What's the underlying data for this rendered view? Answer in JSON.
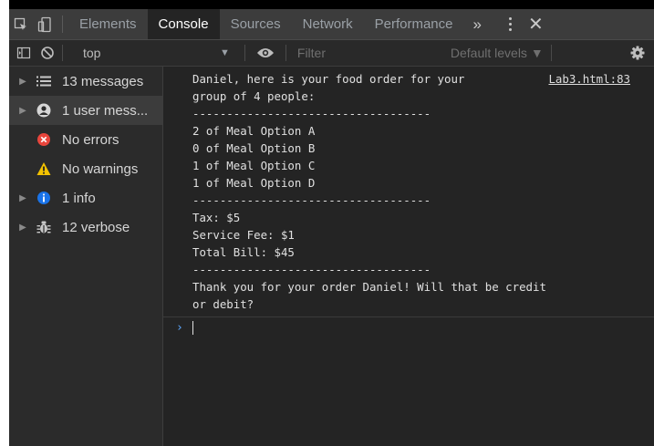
{
  "tabs": {
    "elements": "Elements",
    "console": "Console",
    "sources": "Sources",
    "network": "Network",
    "performance": "Performance",
    "more": "»"
  },
  "toolbar": {
    "context": "top",
    "filter_placeholder": "Filter",
    "levels": "Default levels ▼"
  },
  "sidebar": {
    "items": [
      {
        "label": "13 messages",
        "icon": "list-icon"
      },
      {
        "label": "1 user mess...",
        "icon": "user-icon"
      },
      {
        "label": "No errors",
        "icon": "error-icon"
      },
      {
        "label": "No warnings",
        "icon": "warning-icon"
      },
      {
        "label": "1 info",
        "icon": "info-icon"
      },
      {
        "label": "12 verbose",
        "icon": "bug-icon"
      }
    ]
  },
  "console": {
    "source_link": "Lab3.html:83",
    "lines": [
      "Daniel, here is your food order for your",
      "group of 4 people:",
      "-----------------------------------",
      "2 of Meal Option A",
      "0 of Meal Option B",
      "1 of Meal Option C",
      "1 of Meal Option D",
      "-----------------------------------",
      "Tax: $5",
      "Service Fee: $1",
      "Total Bill: $45",
      "-----------------------------------",
      "Thank you for your order Daniel! Will that be credit",
      "or debit?"
    ],
    "prompt": "›"
  },
  "colors": {
    "accent_blue": "#5da8ff",
    "error_red": "#e8453c",
    "warning_yellow": "#f2c200",
    "info_blue": "#1a73e8"
  }
}
